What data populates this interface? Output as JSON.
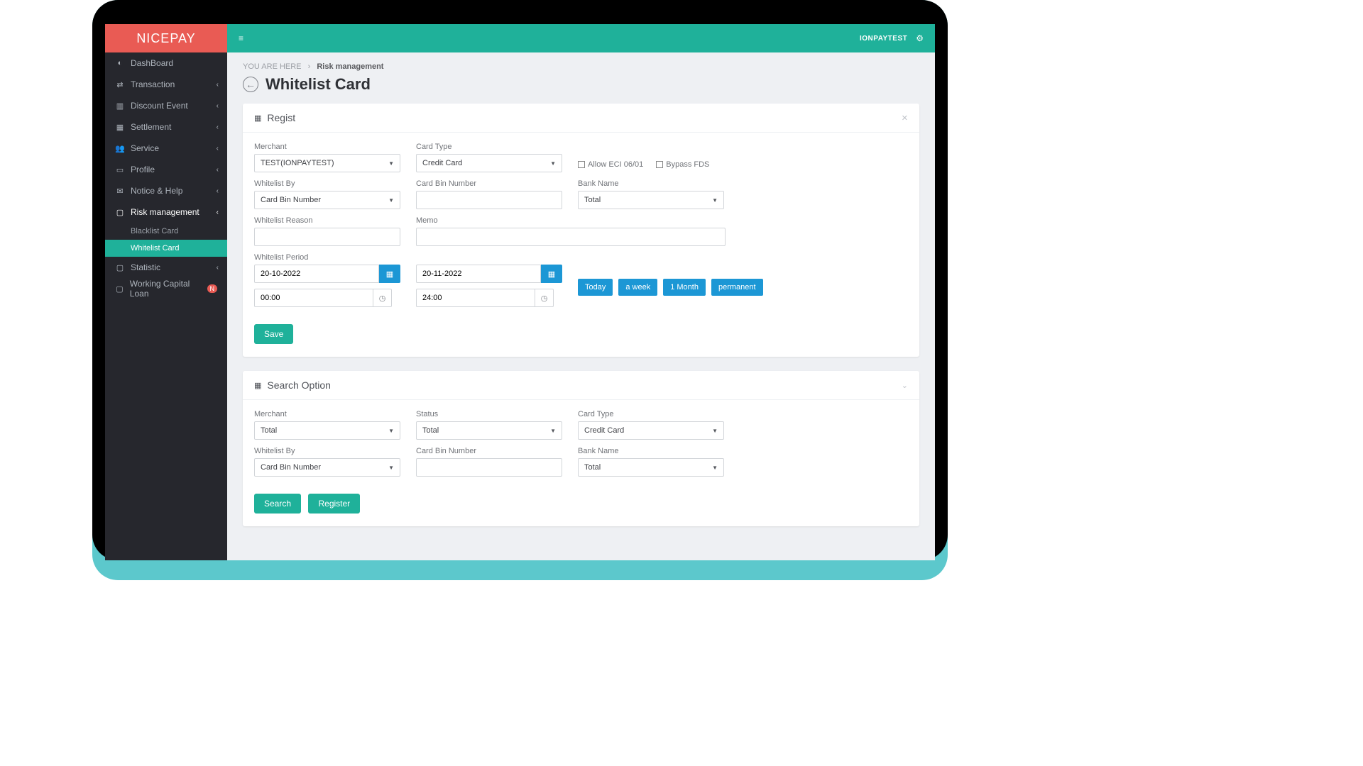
{
  "brand": "NICEPAY",
  "topbar": {
    "user": "IONPAYTEST"
  },
  "breadcrumb": {
    "prefix": "YOU ARE HERE",
    "current": "Risk management"
  },
  "page_title": "Whitelist Card",
  "sidebar": {
    "items": [
      {
        "label": "DashBoard"
      },
      {
        "label": "Transaction"
      },
      {
        "label": "Discount Event"
      },
      {
        "label": "Settlement"
      },
      {
        "label": "Service"
      },
      {
        "label": "Profile"
      },
      {
        "label": "Notice & Help"
      },
      {
        "label": "Risk management"
      },
      {
        "label": "Statistic"
      },
      {
        "label": "Working Capital Loan",
        "badge": "N"
      }
    ],
    "risk_sub": [
      {
        "label": "Blacklist Card"
      },
      {
        "label": "Whitelist Card"
      }
    ]
  },
  "regist": {
    "title": "Regist",
    "labels": {
      "merchant": "Merchant",
      "card_type": "Card Type",
      "whitelist_by": "Whitelist By",
      "card_bin": "Card Bin Number",
      "bank_name": "Bank Name",
      "reason": "Whitelist Reason",
      "memo": "Memo",
      "period": "Whitelist Period"
    },
    "values": {
      "merchant": "TEST(IONPAYTEST)",
      "card_type": "Credit Card",
      "whitelist_by": "Card Bin Number",
      "bank_name": "Total",
      "date_from": "20-10-2022",
      "date_to": "20-11-2022",
      "time_from": "00:00",
      "time_to": "24:00"
    },
    "checkboxes": {
      "allow_eci": "Allow ECI 06/01",
      "bypass_fds": "Bypass FDS"
    },
    "quick": {
      "today": "Today",
      "week": "a week",
      "month": "1 Month",
      "perm": "permanent"
    },
    "save": "Save"
  },
  "search": {
    "title": "Search Option",
    "labels": {
      "merchant": "Merchant",
      "status": "Status",
      "card_type": "Card Type",
      "whitelist_by": "Whitelist By",
      "card_bin": "Card Bin Number",
      "bank_name": "Bank Name"
    },
    "values": {
      "merchant": "Total",
      "status": "Total",
      "card_type": "Credit Card",
      "whitelist_by": "Card Bin Number",
      "bank_name": "Total"
    },
    "buttons": {
      "search": "Search",
      "register": "Register"
    }
  }
}
